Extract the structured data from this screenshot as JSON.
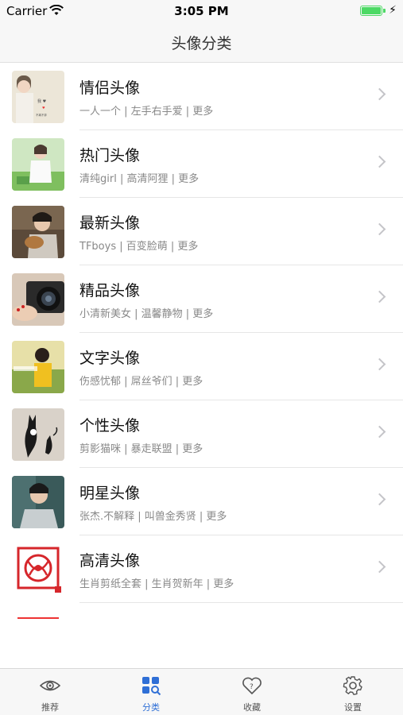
{
  "status_bar": {
    "carrier": "Carrier",
    "time": "3:05 PM"
  },
  "navbar": {
    "title": "头像分类"
  },
  "categories": [
    {
      "title": "情侣头像",
      "subtitle": "一人一个 | 左手右手爱 | 更多",
      "thumb": "couple-avatar-thumbnail"
    },
    {
      "title": "热门头像",
      "subtitle": "清纯girl | 高清阿狸 | 更多",
      "thumb": "popular-avatar-thumbnail"
    },
    {
      "title": "最新头像",
      "subtitle": "TFboys | 百变脸萌 | 更多",
      "thumb": "newest-avatar-thumbnail"
    },
    {
      "title": "精品头像",
      "subtitle": "小清新美女 | 温馨静物 | 更多",
      "thumb": "premium-avatar-thumbnail"
    },
    {
      "title": "文字头像",
      "subtitle": "伤感忧郁 | 屌丝爷们 | 更多",
      "thumb": "text-avatar-thumbnail"
    },
    {
      "title": "个性头像",
      "subtitle": "剪影猫咪 | 暴走联盟 | 更多",
      "thumb": "personality-avatar-thumbnail"
    },
    {
      "title": "明星头像",
      "subtitle": "张杰.不解释 | 叫兽金秀贤 | 更多",
      "thumb": "celebrity-avatar-thumbnail"
    },
    {
      "title": "高清头像",
      "subtitle": "生肖剪纸全套 | 生肖贺新年 | 更多",
      "thumb": "hd-avatar-thumbnail"
    }
  ],
  "tabbar": {
    "items": [
      {
        "label": "推荐",
        "icon": "eye-icon",
        "active": false
      },
      {
        "label": "分类",
        "icon": "grid-search-icon",
        "active": true
      },
      {
        "label": "收藏",
        "icon": "heart-question-icon",
        "active": false
      },
      {
        "label": "设置",
        "icon": "gear-icon",
        "active": false
      }
    ]
  },
  "colors": {
    "accent": "#2f6fd6",
    "battery": "#4cd964",
    "text_secondary": "#888888"
  }
}
